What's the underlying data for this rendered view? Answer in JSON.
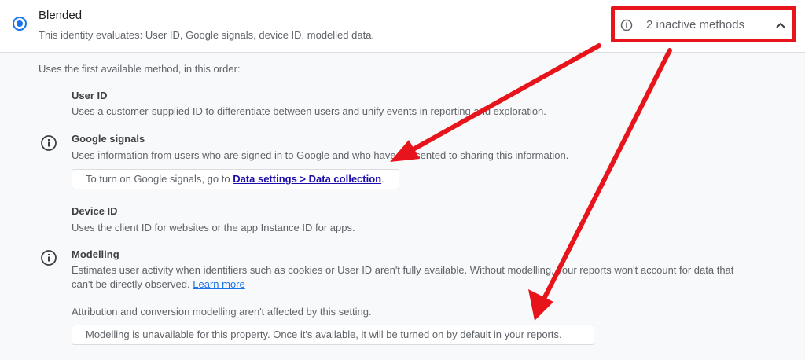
{
  "header": {
    "title": "Blended",
    "description": "This identity evaluates: User ID, Google signals, device ID, modelled data.",
    "inactive_label": "2 inactive methods"
  },
  "intro": "Uses the first available method, in this order:",
  "methods": [
    {
      "title": "User ID",
      "description": "Uses a customer-supplied ID to differentiate between users and unify events in reporting and exploration."
    },
    {
      "title": "Google signals",
      "description": "Uses information from users who are signed in to Google and who have consented to sharing this information.",
      "notice_prefix": "To turn on Google signals, go to ",
      "notice_link": "Data settings > Data collection",
      "notice_suffix": "."
    },
    {
      "title": "Device ID",
      "description": "Uses the client ID for websites or the app Instance ID for apps."
    },
    {
      "title": "Modelling",
      "description_line1": "Estimates user activity when identifiers such as cookies or User ID aren't fully available. Without modelling, your reports won't account for data that",
      "description_line2": "can't be directly observed.",
      "learn_more": "Learn more",
      "note": "Attribution and conversion modelling aren't affected by this setting.",
      "notice": "Modelling is unavailable for this property. Once it's available, it will be turned on by default in your reports."
    }
  ],
  "icons": {
    "info": "info-icon",
    "chevron": "chevron-up-icon"
  },
  "colors": {
    "accent": "#1a73e8",
    "annotation": "#e8141b"
  }
}
